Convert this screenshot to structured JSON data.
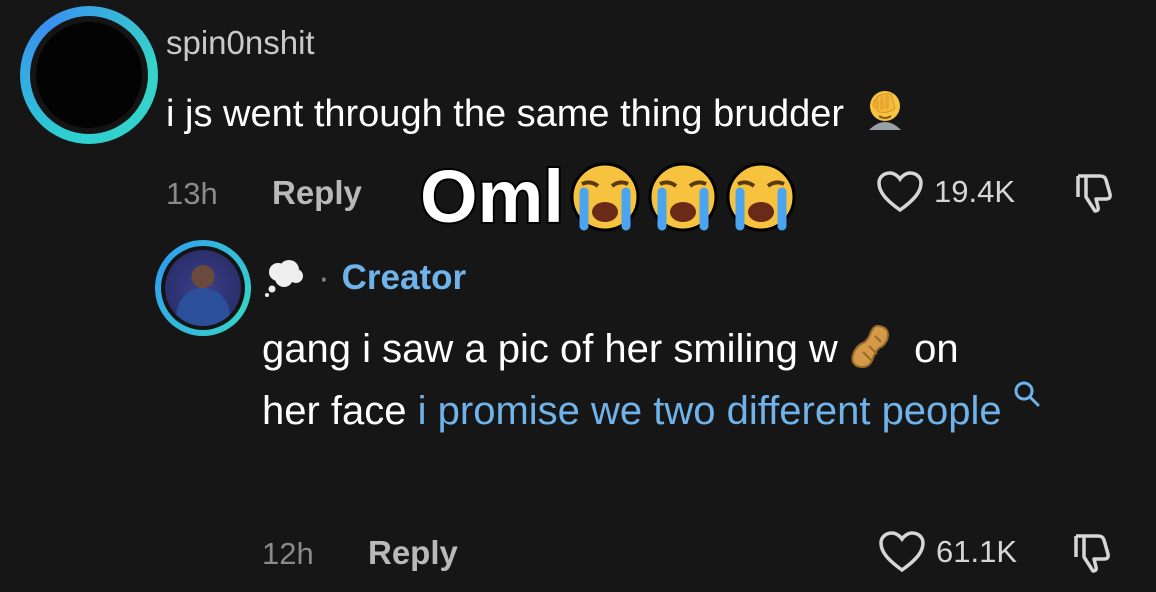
{
  "comment": {
    "username": "spin0nshit",
    "text": "i js went through the same thing brudder",
    "emoji_icon": "facepalm-icon",
    "time": "13h",
    "reply_label": "Reply",
    "likes": "19.4K"
  },
  "overlay": {
    "text": "Oml",
    "emoji_icon": "loudly-crying-face-icon",
    "emoji_count": 3
  },
  "reply": {
    "status_icon": "thought-bubble-icon",
    "separator": "·",
    "badge": "Creator",
    "text_before": "gang i saw a pic of her smiling w",
    "inline_emoji": "peanut-icon",
    "text_after": "on",
    "text_line2": "her face",
    "link_text": "i promise we two different people",
    "link_icon": "search-icon",
    "time": "12h",
    "reply_label": "Reply",
    "likes": "61.1K"
  },
  "colors": {
    "background": "#161616",
    "accent_link": "#6fb3ea",
    "avatar_ring": "#2ecfd1"
  }
}
